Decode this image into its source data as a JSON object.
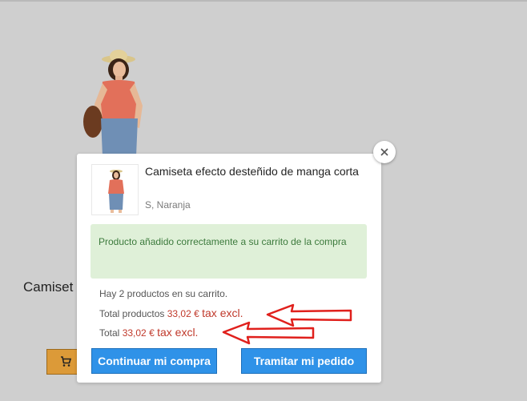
{
  "background": {
    "product_title": "Camiset"
  },
  "modal": {
    "product_name": "Camiseta efecto desteñido de manga corta",
    "product_attributes": "S, Naranja",
    "success_message": "Producto añadido correctamente a su carrito de la compra",
    "cart_count_text": "Hay 2 productos en su carrito.",
    "total_products_label": "Total productos",
    "total_products_amount": "33,02 €",
    "total_products_tax": "tax excl.",
    "total_label": "Total",
    "total_amount": "33,02 €",
    "total_tax": "tax excl.",
    "continue_button": "Continuar mi compra",
    "checkout_button": "Tramitar mi pedido"
  },
  "icons": {
    "close": "close-icon",
    "cart": "cart-icon",
    "arrows": "red-annotation-arrow"
  },
  "colors": {
    "overlay_bg": "#cfcfcf",
    "success_bg": "#dff0d8",
    "success_text": "#3c7a3c",
    "price_red": "#c0392b",
    "button_blue": "#2f92e8",
    "cart_button_orange": "#dc9a38",
    "annotation_red": "#e0201c"
  }
}
